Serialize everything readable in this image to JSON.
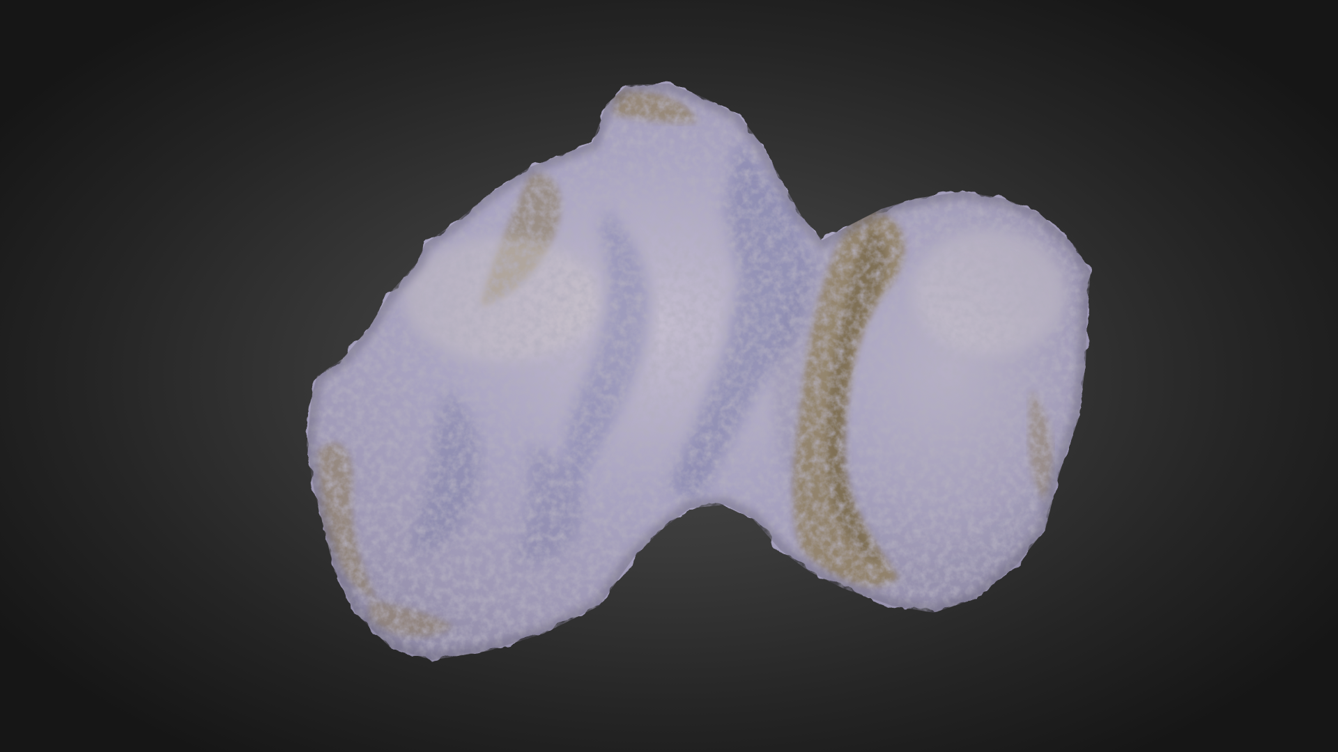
{
  "viewer": {
    "background_center": "#4b4b4b",
    "background_edge": "#161616"
  },
  "model": {
    "object": "comet-nucleus-3d-model",
    "colors": {
      "lit_surface": "#b9b2c4",
      "shadow_tint": "#7d7ea8",
      "ochre_terrain": "#8f7d55",
      "ochre_dark": "#6e5f3f",
      "highlight": "#d8d0c8"
    }
  }
}
